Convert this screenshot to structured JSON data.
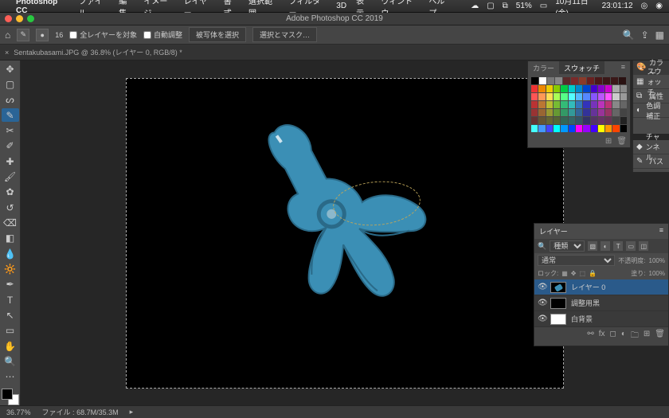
{
  "menubar": {
    "app": "Photoshop CC",
    "items": [
      "ファイル",
      "編集",
      "イメージ",
      "レイヤー",
      "書式",
      "選択範囲",
      "フィルター",
      "3D",
      "表示",
      "ウィンドウ",
      "ヘルプ"
    ],
    "battery": "51%",
    "date": "10月11日(金)",
    "time": "23:01:12"
  },
  "window_title": "Adobe Photoshop CC 2019",
  "optionsbar": {
    "width": "16",
    "all_layers_label": "全レイヤーを対象",
    "autoenhance_label": "自動調整",
    "buttons": [
      "被写体を選択",
      "選択とマスク…"
    ]
  },
  "document_tab": "Sentakubasami.JPG @ 36.8% (レイヤー 0, RGB/8) *",
  "swatchpanel": {
    "tab_color": "カラー",
    "tab_swatch": "スウォッチ",
    "rows": [
      [
        "#000",
        "#fff",
        "#777",
        "#888",
        "#5a2a2a",
        "#7a2a2a",
        "#8a3a2a",
        "#6a2020",
        "#4a1818",
        "#3a1818",
        "#3a1818",
        "#2a1212"
      ],
      [
        "#e33",
        "#e80",
        "#ec0",
        "#8c0",
        "#0c4",
        "#0cc",
        "#08c",
        "#04c",
        "#40c",
        "#80c",
        "#c0c",
        "#aaa",
        "#888"
      ],
      [
        "#f55",
        "#f95",
        "#fd5",
        "#af5",
        "#5f8",
        "#5ff",
        "#5bf",
        "#58f",
        "#85f",
        "#b5f",
        "#f5f",
        "#ccc",
        "#999"
      ],
      [
        "#b33",
        "#b73",
        "#bb3",
        "#7b3",
        "#3b7",
        "#3bb",
        "#37b",
        "#33b",
        "#73b",
        "#b3b",
        "#b37",
        "#888",
        "#666"
      ],
      [
        "#933",
        "#963",
        "#993",
        "#693",
        "#396",
        "#399",
        "#369",
        "#339",
        "#639",
        "#939",
        "#936",
        "#666",
        "#444"
      ],
      [
        "#633",
        "#653",
        "#663",
        "#563",
        "#365",
        "#366",
        "#356",
        "#336",
        "#536",
        "#636",
        "#635",
        "#444",
        "#222"
      ],
      [
        "#4ff",
        "#49f",
        "#44f",
        "#0ff",
        "#09f",
        "#04f",
        "#f0f",
        "#90f",
        "#40f",
        "#ff0",
        "#f90",
        "#f40",
        "#000"
      ]
    ]
  },
  "right_tabs": {
    "color": "カラー",
    "swatch": "スウォッチ",
    "props": "属性",
    "adjust": "色調補正",
    "channel": "チャンネル",
    "paths": "パス"
  },
  "layers": {
    "title": "レイヤー",
    "kind": "種類",
    "mode": "通常",
    "opacity_label": "不透明度:",
    "opacity": "100%",
    "lock_label": "ロック:",
    "fill_label": "塗り:",
    "fill": "100%",
    "items": [
      {
        "name": "レイヤー 0",
        "selected": true,
        "visible": true,
        "thumb": "mini"
      },
      {
        "name": "調整用黒",
        "selected": false,
        "visible": true,
        "thumb": "black"
      },
      {
        "name": "白背景",
        "selected": false,
        "visible": true,
        "thumb": "white"
      }
    ]
  },
  "status": {
    "zoom": "36.77%",
    "filesize_label": "ファイル :",
    "filesize": "68.7M/35.3M"
  }
}
